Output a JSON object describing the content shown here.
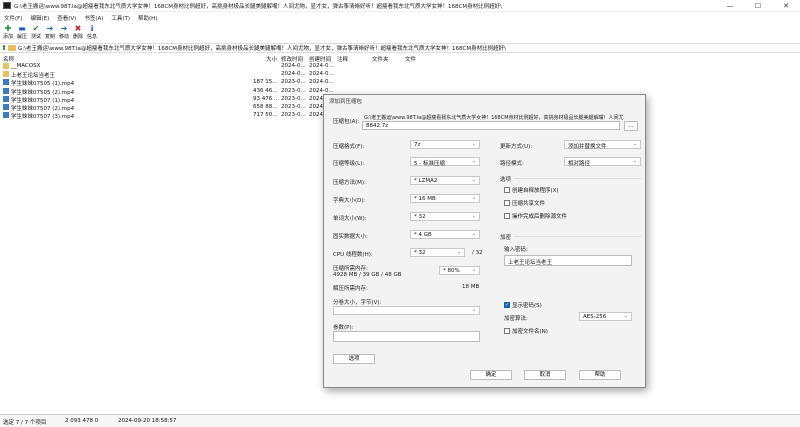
{
  "window": {
    "title": "G:\\老王搬运\\www.98T.la@超瘦看我东北气质大学女神！168CM身材比例超好，高挑身材极品长腿美腿解嘴！人间尤物，显才女，弹古筝清晰好听！超瘦看我东北气质大学女神！168CM身材比例超好\\",
    "controls": [
      "—",
      "☐",
      "✕"
    ]
  },
  "menu": [
    "文件(F)",
    "编辑(E)",
    "查看(V)",
    "书签(A)",
    "工具(T)",
    "帮助(H)"
  ],
  "toolbar": [
    {
      "label": "添加",
      "icon": "add-icon",
      "glyph": "✚",
      "color": "#2a8a2a"
    },
    {
      "label": "解压",
      "icon": "extract-icon",
      "glyph": "▬",
      "color": "#1a5fb4"
    },
    {
      "label": "测试",
      "icon": "test-icon",
      "glyph": "✔",
      "color": "#2a8a2a"
    },
    {
      "label": "复制",
      "icon": "copy-icon",
      "glyph": "➔",
      "color": "#1a5fb4"
    },
    {
      "label": "移动",
      "icon": "move-icon",
      "glyph": "➔",
      "color": "#1a5fb4"
    },
    {
      "label": "删除",
      "icon": "delete-icon",
      "glyph": "✖",
      "color": "#c0262d"
    },
    {
      "label": "信息",
      "icon": "info-icon",
      "glyph": "ℹ",
      "color": "#1a5fb4"
    }
  ],
  "address": {
    "path": "G:\\老王搬运\\www.98T.la@超瘦看我东北气质大学女神！168CM身材比例超好，高挑身材极品长腿美腿解嘴！人间尤物，显才女，弹古筝清晰好听！超瘦看我东北气质大学女神！168CM身材比例超好\\"
  },
  "columns": [
    "名称",
    "大小",
    "修改时间",
    "创建时间",
    "注释",
    "文件夹",
    "文件"
  ],
  "files": [
    {
      "name": "__MACOSX",
      "size": "",
      "modified": "2024-0...",
      "created": "2024-0...",
      "type": "folder"
    },
    {
      "name": "上老王论坛当老王",
      "size": "",
      "modified": "2024-0...",
      "created": "2024-0...",
      "type": "folder"
    },
    {
      "name": "学生妹妹07505 (1).mp4",
      "size": "187 15...",
      "modified": "2023-0...",
      "created": "2024-0...",
      "type": "video"
    },
    {
      "name": "学生妹妹07505 (2).mp4",
      "size": "436 46...",
      "modified": "2023-0...",
      "created": "2024-0...",
      "type": "video"
    },
    {
      "name": "学生妹妹07507 (1).mp4",
      "size": "93 476 ...",
      "modified": "2023-0...",
      "created": "2024-0...",
      "type": "video"
    },
    {
      "name": "学生妹妹07507 (2).mp4",
      "size": "658 88...",
      "modified": "2023-0...",
      "created": "2024-0...",
      "type": "video"
    },
    {
      "name": "学生妹妹07507 (3).mp4",
      "size": "717 50...",
      "modified": "2023-0...",
      "created": "2024-0...",
      "type": "video"
    }
  ],
  "status": {
    "selection": "选定 7 / 7 个项目",
    "total_size": "2 093 478 0",
    "datetime": "2024-09-20 18:58:57"
  },
  "dialog": {
    "title": "添加到压缩包",
    "archive_label": "压缩包(A):",
    "archive_path_line1": "G:\\老王搬运\\www.98T.la@超瘦看我东北气质大学女神！168CM身材比例超好，高挑身材极品长腿美腿解嘴！人间尤",
    "archive_path_line2": "8842.7z",
    "browse_label": "...",
    "format_label": "压缩格式(F):",
    "format_value": "7z",
    "level_label": "压缩等级(L):",
    "level_value": "5 - 标准压缩",
    "method_label": "压缩方法(M):",
    "method_value": "* LZMA2",
    "dict_label": "字典大小(D):",
    "dict_value": "* 16 MB",
    "word_label": "单词大小(W):",
    "word_value": "* 32",
    "solid_label": "固实数据大小:",
    "solid_value": "* 4 GB",
    "cpu_label": "CPU 线程数(H):",
    "cpu_value": "* 32",
    "cpu_total": "/ 32",
    "mem_label": "压缩所需内存:",
    "mem_detail": "4928 MB / 39 GB / 48 GB",
    "mem_value": "* 80%",
    "decomp_label": "解压所需内存:",
    "decomp_value": "18 MB",
    "split_label": "分卷大小，字节(V):",
    "params_label": "参数(P):",
    "options_button": "选项",
    "update_label": "更新方式(U):",
    "update_value": "添加并替换文件",
    "pathmode_label": "路径模式:",
    "pathmode_value": "相对路径",
    "options_group": "选项",
    "opt_sfx": "创建自释放程序(X)",
    "opt_shared": "压缩共享文件",
    "opt_delete": "操作完成后删除源文件",
    "encrypt_group": "加密",
    "password_label": "输入密码:",
    "password_value": "上老王论坛当老王",
    "show_password": "显示密码(S)",
    "encrypt_method_label": "加密算法:",
    "encrypt_method_value": "AES-256",
    "encrypt_names": "加密文件名(N)",
    "ok_button": "确定",
    "cancel_button": "取消",
    "help_button": "帮助"
  }
}
